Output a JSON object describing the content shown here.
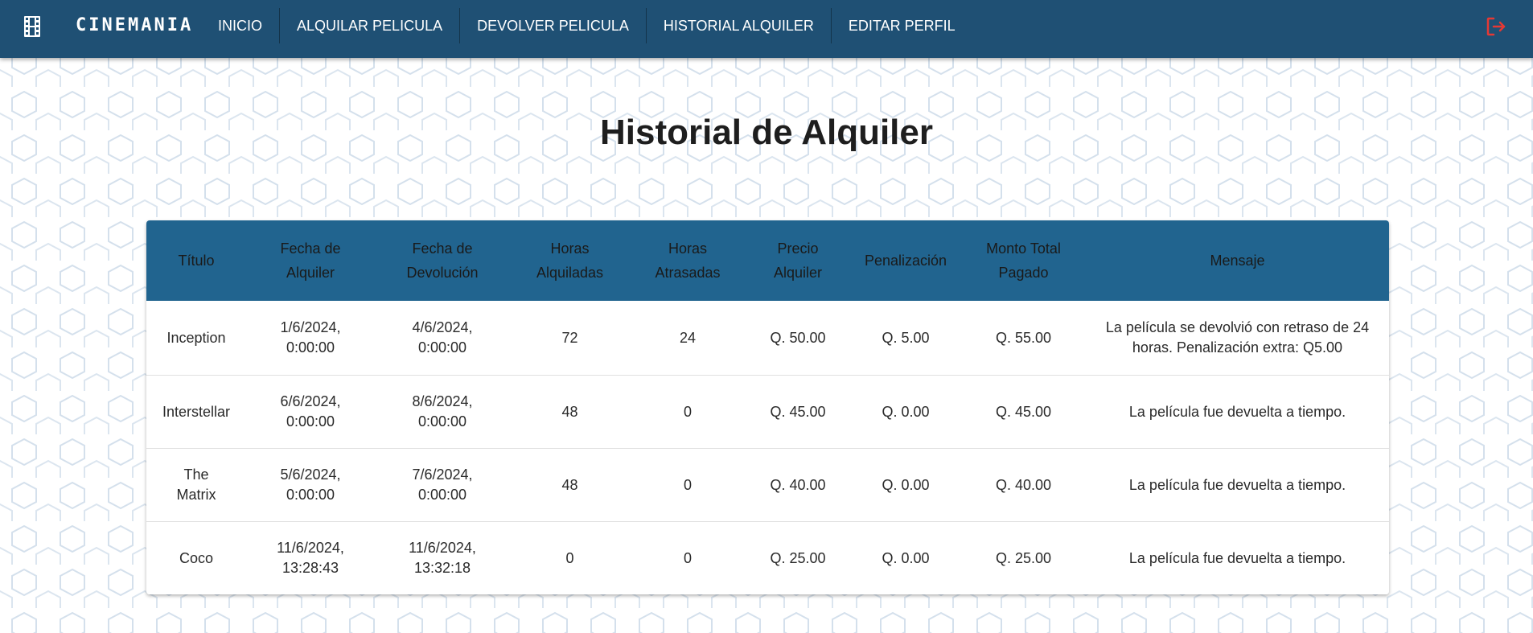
{
  "app": {
    "brand": "CINEMANIA",
    "accent_color": "#1f5074",
    "header_color": "#21648f",
    "logout_color": "#e53935"
  },
  "nav": {
    "items": [
      {
        "label": "INICIO"
      },
      {
        "label": "ALQUILAR PELICULA"
      },
      {
        "label": "DEVOLVER PELICULA"
      },
      {
        "label": "HISTORIAL ALQUILER"
      },
      {
        "label": "EDITAR PERFIL"
      }
    ],
    "icons": {
      "brand_icon": "film-icon",
      "logout_icon": "logout-icon"
    }
  },
  "page": {
    "title": "Historial de Alquiler"
  },
  "table": {
    "headers": [
      {
        "line1": "Título",
        "line2": ""
      },
      {
        "line1": "Fecha de",
        "line2": "Alquiler"
      },
      {
        "line1": "Fecha de",
        "line2": "Devolución"
      },
      {
        "line1": "Horas",
        "line2": "Alquiladas"
      },
      {
        "line1": "Horas",
        "line2": "Atrasadas"
      },
      {
        "line1": "Precio",
        "line2": "Alquiler"
      },
      {
        "line1": "Penalización",
        "line2": ""
      },
      {
        "line1": "Monto Total",
        "line2": "Pagado"
      },
      {
        "line1": "Mensaje",
        "line2": ""
      }
    ],
    "rows": [
      {
        "titulo": "Inception",
        "fecha_alquiler": [
          "1/6/2024,",
          "0:00:00"
        ],
        "fecha_devolucion": [
          "4/6/2024,",
          "0:00:00"
        ],
        "horas_alquiladas": "72",
        "horas_atrasadas": "24",
        "precio": "Q. 50.00",
        "penalizacion": "Q. 5.00",
        "monto_total": "Q. 55.00",
        "mensaje": "La película se devolvió con retraso de 24 horas. Penalización extra: Q5.00"
      },
      {
        "titulo": "Interstellar",
        "fecha_alquiler": [
          "6/6/2024,",
          "0:00:00"
        ],
        "fecha_devolucion": [
          "8/6/2024,",
          "0:00:00"
        ],
        "horas_alquiladas": "48",
        "horas_atrasadas": "0",
        "precio": "Q. 45.00",
        "penalizacion": "Q. 0.00",
        "monto_total": "Q. 45.00",
        "mensaje": "La película fue devuelta a tiempo."
      },
      {
        "titulo": "The Matrix",
        "fecha_alquiler": [
          "5/6/2024,",
          "0:00:00"
        ],
        "fecha_devolucion": [
          "7/6/2024,",
          "0:00:00"
        ],
        "horas_alquiladas": "48",
        "horas_atrasadas": "0",
        "precio": "Q. 40.00",
        "penalizacion": "Q. 0.00",
        "monto_total": "Q. 40.00",
        "mensaje": "La película fue devuelta a tiempo."
      },
      {
        "titulo": "Coco",
        "fecha_alquiler": [
          "11/6/2024,",
          "13:28:43"
        ],
        "fecha_devolucion": [
          "11/6/2024,",
          "13:32:18"
        ],
        "horas_alquiladas": "0",
        "horas_atrasadas": "0",
        "precio": "Q. 25.00",
        "penalizacion": "Q. 0.00",
        "monto_total": "Q. 25.00",
        "mensaje": "La película fue devuelta a tiempo."
      }
    ]
  }
}
